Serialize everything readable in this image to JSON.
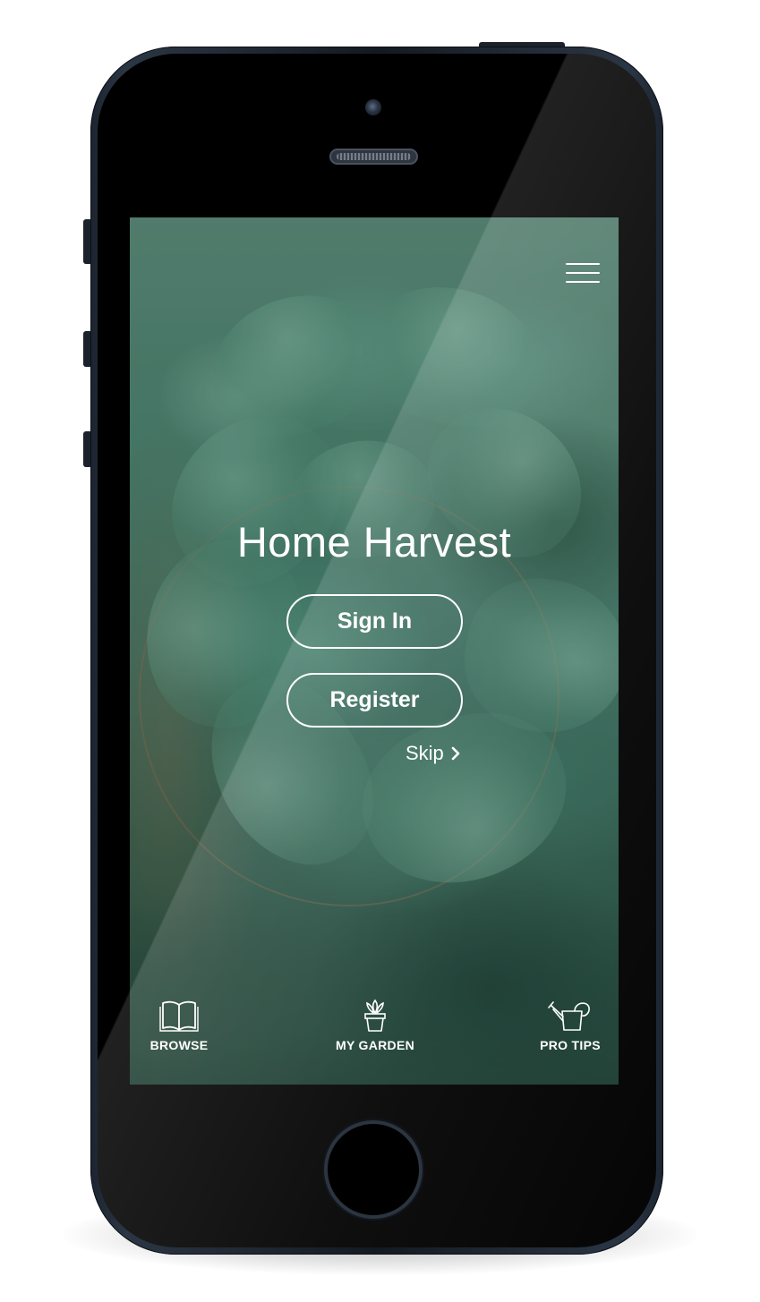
{
  "app": {
    "title": "Home Harvest"
  },
  "auth": {
    "sign_in_label": "Sign In",
    "register_label": "Register",
    "skip_label": "Skip"
  },
  "header": {
    "menu_icon": "hamburger-menu-icon"
  },
  "bottom_nav": {
    "items": [
      {
        "label": "BROWSE",
        "icon": "open-book-icon"
      },
      {
        "label": "MY GARDEN",
        "icon": "potted-plant-icon"
      },
      {
        "label": "PRO TIPS",
        "icon": "watering-can-icon"
      }
    ]
  },
  "colors": {
    "text": "#ffffff",
    "background_green": "#3f7666",
    "phone_body": "#141a22"
  }
}
